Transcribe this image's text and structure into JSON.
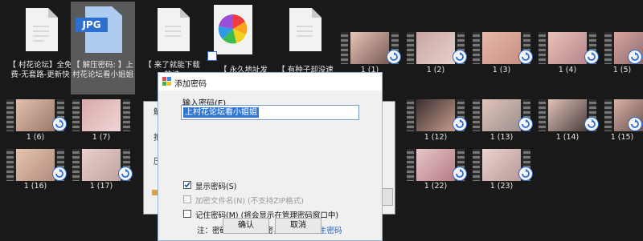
{
  "desktop": {
    "files": [
      {
        "label": "【 村花论坛】全免费-无套路-更新快"
      },
      {
        "label": "【 解压密码: 】上村花论坛看小姐姐",
        "badge": "JPG"
      },
      {
        "label": "【 来了就能下载的诗"
      },
      {
        "label": "【 永久地址发布"
      },
      {
        "label": "【 有种子却没速"
      }
    ],
    "videos": [
      {
        "label": "1 (1)"
      },
      {
        "label": "1 (2)"
      },
      {
        "label": "1 (3)"
      },
      {
        "label": "1 (4)"
      },
      {
        "label": "1 (5)"
      },
      {
        "label": "1 (6)"
      },
      {
        "label": "1 (7)"
      },
      {
        "label": "1 (12)"
      },
      {
        "label": "1 (13)"
      },
      {
        "label": "1 (14)"
      },
      {
        "label": "1 (15)"
      },
      {
        "label": "1 (16)"
      },
      {
        "label": "1 (17)"
      },
      {
        "label": "1 (22)"
      },
      {
        "label": "1 (23)"
      }
    ]
  },
  "bg_window": {
    "title_char": "解",
    "row1": "抱",
    "row2": "压"
  },
  "dialog": {
    "title": "添加密码",
    "prompt_label": "输入密码(E)",
    "password_value": "上村花论坛看小姐姐",
    "show_password": {
      "label": "显示密码(S)",
      "checked": true
    },
    "encrypt_names": {
      "label": "加密文件名(N)",
      "note": "(不支持ZIP格式)",
      "enabled": false
    },
    "remember": {
      "label": "记住密码(M)",
      "note": "(将会显示在管理密码窗口中)"
    },
    "notice_prefix": "注：密码没有安全加密，建议先",
    "notice_link": "设置主密码",
    "ok_button": "确认",
    "cancel_button": "取消"
  },
  "colors": {
    "accent": "#3078d8",
    "desktop_bg": "#191919"
  }
}
